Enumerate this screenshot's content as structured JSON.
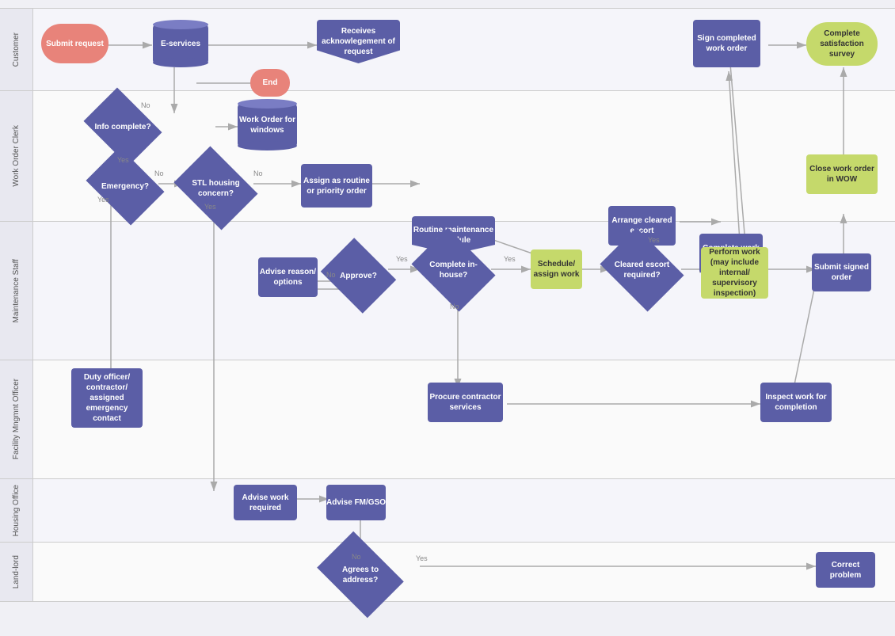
{
  "lanes": [
    {
      "id": "customer",
      "label": "Customer"
    },
    {
      "id": "clerk",
      "label": "Work Order Clerk"
    },
    {
      "id": "maintenance",
      "label": "Maintenance Staff"
    },
    {
      "id": "facility",
      "label": "Facility Mngmnt Officer"
    },
    {
      "id": "housing",
      "label": "Housing Office"
    },
    {
      "id": "landlord",
      "label": "Land-lord"
    }
  ],
  "nodes": {
    "submit_request": "Submit request",
    "e_services": "E-services",
    "receives_ack": "Receives acknowlegement of request",
    "sign_completed": "Sign completed work order",
    "complete_survey": "Complete satisfaction survey",
    "end": "End",
    "info_complete": "Info complete?",
    "work_order_windows": "Work Order for windows",
    "emergency": "Emergency?",
    "stl_housing": "STL housing concern?",
    "close_work_order": "Close work order in WOW",
    "assign_routine": "Assign as routine or priority order",
    "routine_maintenance": "Routine maintenance schedule",
    "arrange_escort": "Arrange cleared escort",
    "complete_work_order": "Complete work order",
    "advise_reason": "Advise reason/ options",
    "approve": "Approve?",
    "complete_inhouse": "Complete in-house?",
    "schedule_work": "Schedule/ assign work",
    "cleared_escort": "Cleared escort required?",
    "perform_work": "Perform work (may include internal/ supervisory inspection)",
    "submit_signed": "Submit signed order",
    "procure_contractor": "Procure contractor services",
    "inspect_work": "Inspect work for completion",
    "duty_officer": "Duty officer/ contractor/ assigned emergency contact",
    "advise_work": "Advise work required",
    "advise_fm": "Advise FM/GSO",
    "agrees_address": "Agrees to address?",
    "correct_problem": "Correct problem"
  },
  "labels": {
    "yes": "Yes",
    "no": "No"
  }
}
